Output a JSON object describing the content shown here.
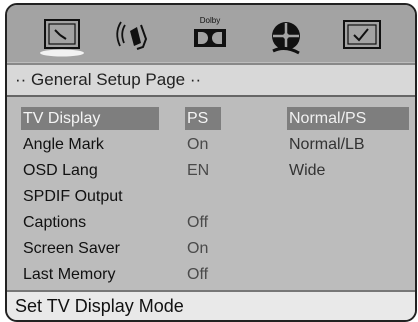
{
  "icon_bar": {
    "icons": [
      {
        "name": "general-setup-icon",
        "selected": true
      },
      {
        "name": "audio-speaker-icon"
      },
      {
        "name": "dolby-icon",
        "label": "Dolby"
      },
      {
        "name": "video-reel-icon"
      },
      {
        "name": "preference-checkbox-icon"
      }
    ]
  },
  "title_bar": {
    "title": "·· General Setup Page ··"
  },
  "settings": [
    {
      "label": "TV Display",
      "value": "PS",
      "selected": true
    },
    {
      "label": "Angle Mark",
      "value": "On"
    },
    {
      "label": "OSD Lang",
      "value": "EN"
    },
    {
      "label": "SPDIF Output",
      "value": ""
    },
    {
      "label": "Captions",
      "value": "Off"
    },
    {
      "label": "Screen Saver",
      "value": "On"
    },
    {
      "label": "Last Memory",
      "value": "Off"
    }
  ],
  "options": [
    {
      "label": "Normal/PS",
      "selected": true
    },
    {
      "label": "Normal/LB"
    },
    {
      "label": "Wide"
    }
  ],
  "status_bar": {
    "text": "Set TV Display Mode"
  }
}
